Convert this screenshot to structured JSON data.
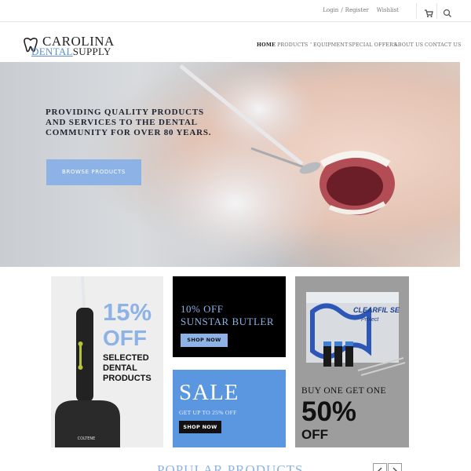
{
  "topbar": {
    "login": "Login",
    "separator": "/",
    "register": "Register",
    "wishlist": "Wishlist",
    "cart_icon": "cart-icon",
    "search_icon": "search-icon"
  },
  "logo": {
    "line1": "CAROLINA",
    "line2_accent": "DENTAL",
    "line2_rest": "SUPPLY",
    "icon": "tooth-icon"
  },
  "nav": {
    "items": [
      "HOME",
      "PRODUCTS",
      "EQUIPMENT",
      "SPECIAL OFFERS",
      "ABOUT US",
      "CONTACT US"
    ],
    "active": "HOME"
  },
  "hero": {
    "headline_line1": "PROVIDING QUALITY PRODUCTS",
    "headline_line2": "AND SERVICES TO THE DENTAL",
    "headline_line3": "COMMUNITY FOR OVER 80 YEARS.",
    "button": "BROWSE PRODUCTS"
  },
  "promos": {
    "tile1": {
      "percent": "15%",
      "off": "OFF",
      "line1": "SELECTED",
      "line2": "DENTAL",
      "line3": "PRODUCTS",
      "product_brand": "COLTENE"
    },
    "tile2": {
      "line1": "10% OFF",
      "line2": "SUNSTAR BUTLER",
      "button": "SHOP NOW"
    },
    "tile3": {
      "title": "SALE",
      "subtitle": "GET UP TO 25% OFF",
      "button": "SHOP NOW"
    },
    "tile4": {
      "line1": "BUY ONE GET ONE",
      "big": "50%",
      "off": "OFF",
      "product_name": "CLEARFIL SE",
      "product_sub": "Protect"
    }
  },
  "popular": {
    "title": "POPULAR PRODUCTS"
  },
  "colors": {
    "accent": "#8db2e6",
    "sale_bg": "#5b96e0",
    "dark": "#000000"
  }
}
